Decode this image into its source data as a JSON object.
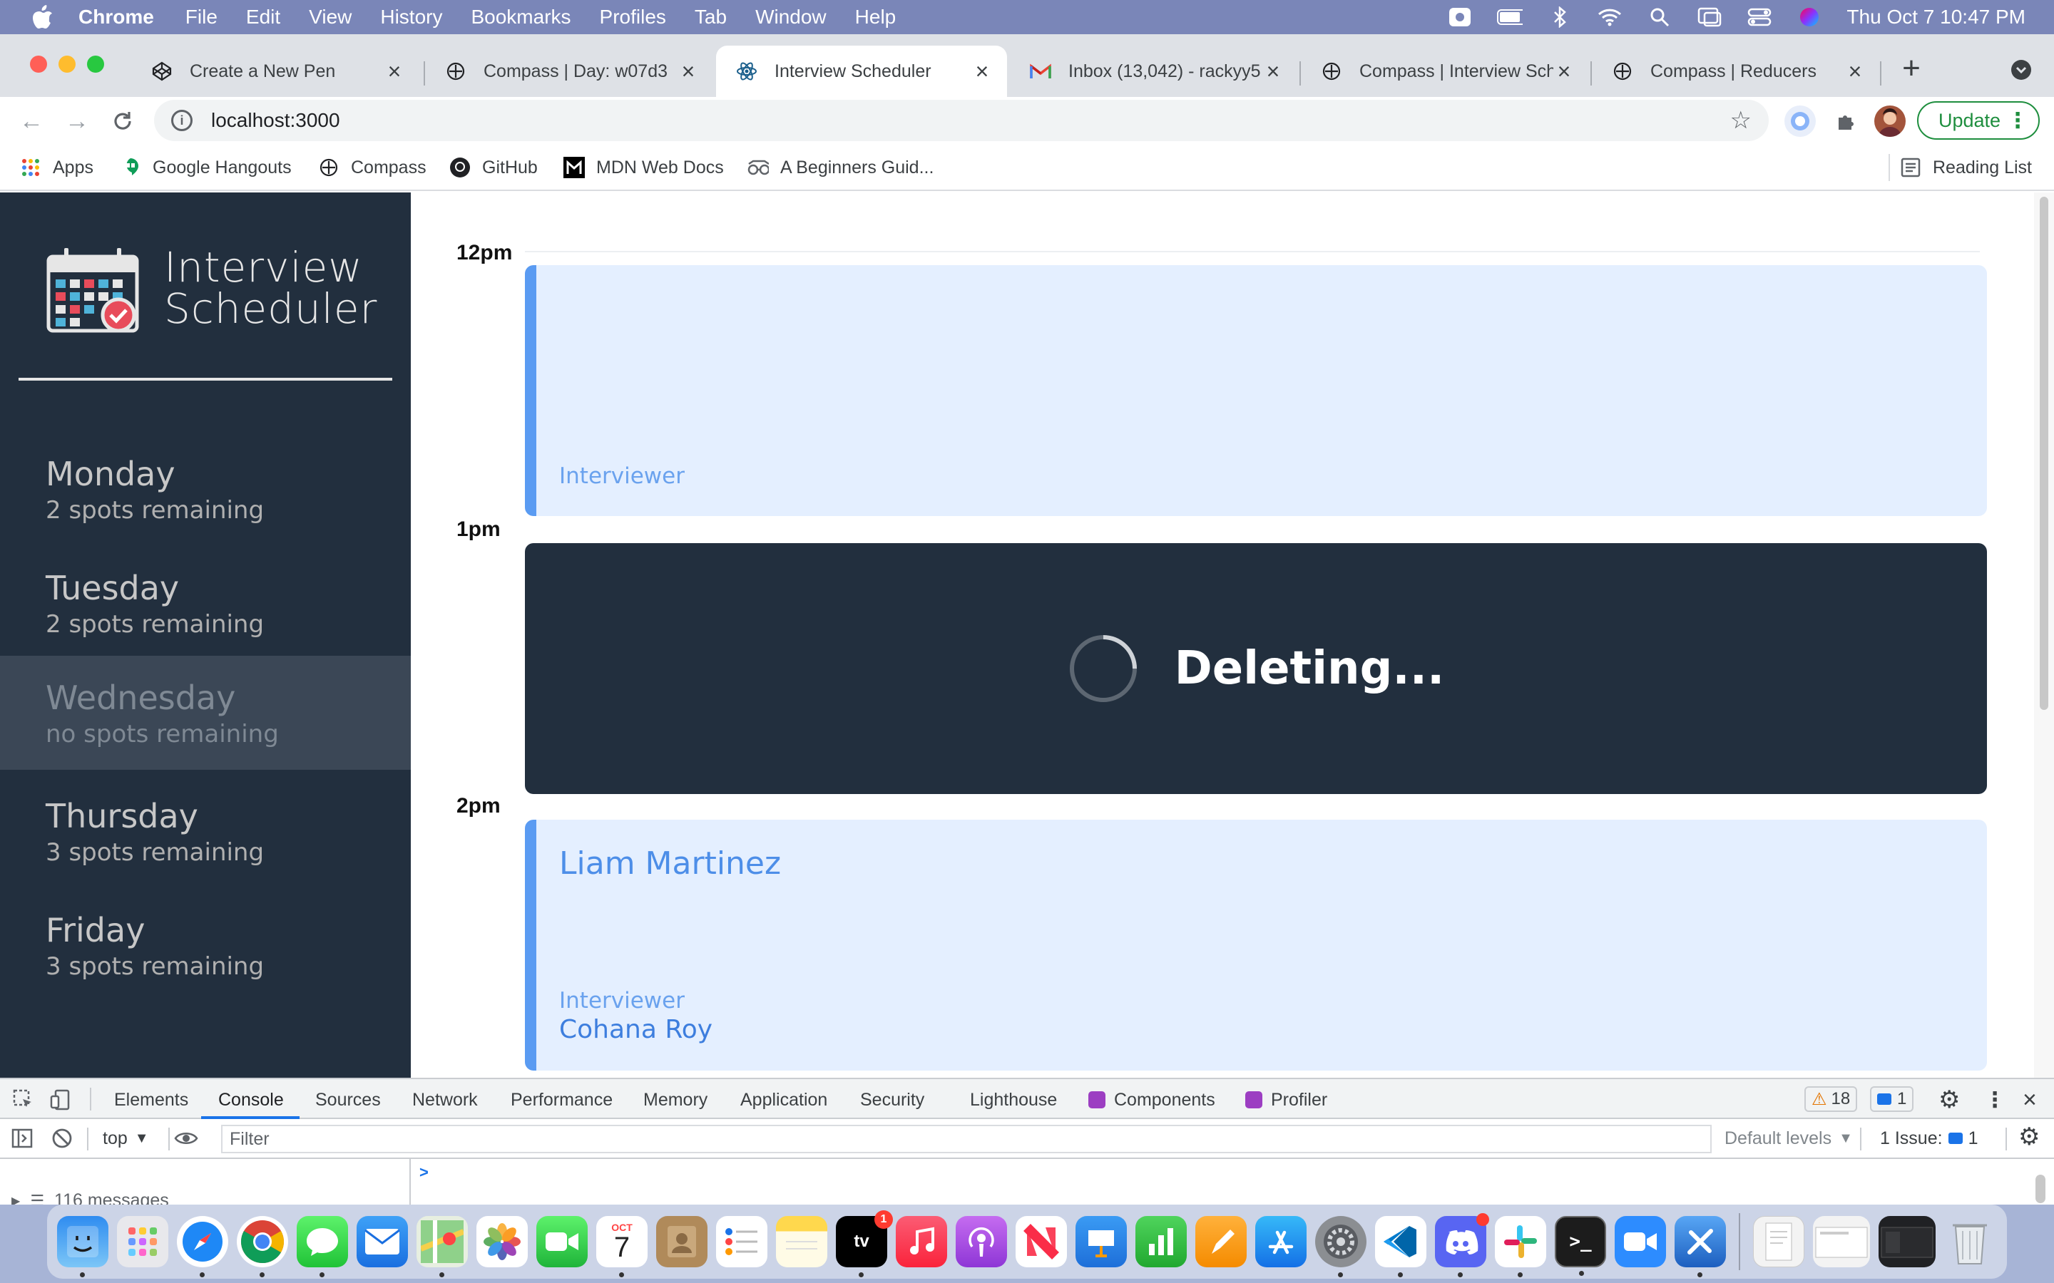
{
  "menubar": {
    "app_name": "Chrome",
    "items": [
      "File",
      "Edit",
      "View",
      "History",
      "Bookmarks",
      "Profiles",
      "Tab",
      "Window",
      "Help"
    ],
    "clock": "Thu Oct 7  10:47 PM"
  },
  "tabs": [
    {
      "title": "Create a New Pen",
      "icon": "codepen-icon"
    },
    {
      "title": "Compass | Day: w07d3",
      "icon": "compass-icon"
    },
    {
      "title": "Interview Scheduler",
      "icon": "react-icon",
      "active": true
    },
    {
      "title": "Inbox (13,042) - rackyy5",
      "icon": "gmail-icon"
    },
    {
      "title": "Compass | Interview Sch",
      "icon": "compass-icon"
    },
    {
      "title": "Compass | Reducers",
      "icon": "compass-icon"
    }
  ],
  "omnibox": {
    "url": "localhost:3000"
  },
  "update_label": "Update",
  "bookmarks": [
    {
      "label": "Apps",
      "icon": "apps-grid-icon"
    },
    {
      "label": "Google Hangouts",
      "icon": "hangouts-icon"
    },
    {
      "label": "Compass",
      "icon": "compass-icon"
    },
    {
      "label": "GitHub",
      "icon": "github-icon"
    },
    {
      "label": "MDN Web Docs",
      "icon": "mdn-icon"
    },
    {
      "label": "A Beginners Guid...",
      "icon": "glasses-icon"
    }
  ],
  "reading_list": "Reading List",
  "app": {
    "brand_line1": "Interview",
    "brand_line2": "Scheduler",
    "days": [
      {
        "name": "Monday",
        "spots": "2 spots remaining"
      },
      {
        "name": "Tuesday",
        "spots": "2 spots remaining"
      },
      {
        "name": "Wednesday",
        "spots": "no spots remaining",
        "selected": true
      },
      {
        "name": "Thursday",
        "spots": "3 spots remaining"
      },
      {
        "name": "Friday",
        "spots": "3 spots remaining"
      }
    ],
    "times": [
      "12pm",
      "1pm",
      "2pm"
    ],
    "appointments": {
      "first": {
        "label": "Interviewer"
      },
      "deleting": {
        "message": "Deleting..."
      },
      "third": {
        "student": "Liam Martinez",
        "label": "Interviewer",
        "interviewer": "Cohana Roy"
      }
    }
  },
  "devtools": {
    "tabs": [
      "Elements",
      "Console",
      "Sources",
      "Network",
      "Performance",
      "Memory",
      "Application",
      "Security",
      "Lighthouse",
      "Components",
      "Profiler"
    ],
    "active_tab": "Console",
    "warnings": "18",
    "messages": "1",
    "context": "top",
    "filter_placeholder": "Filter",
    "levels": "Default levels",
    "issues_label": "1 Issue:",
    "issues_count": "1",
    "message_count": "116 messages",
    "prompt": ">"
  },
  "dock": {
    "calendar_month": "OCT",
    "calendar_day": "7",
    "tv_badge": "1"
  }
}
